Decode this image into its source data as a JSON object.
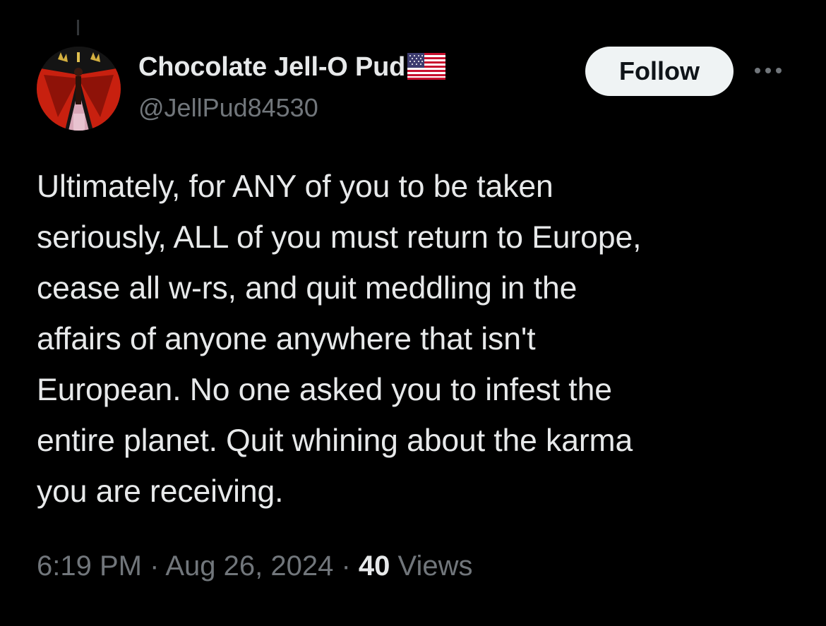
{
  "author": {
    "display_name": "Chocolate Jell-O Pud",
    "flag_icon": "us-flag-icon",
    "handle": "@JellPud84530"
  },
  "actions": {
    "follow_label": "Follow",
    "more_icon": "more-options-icon"
  },
  "tweet": {
    "lines": [
      "Ultimately, for ANY of you to be taken",
      "seriously, ALL of you must return to Europe,",
      "cease all w-rs, and quit meddling in the",
      "affairs of anyone anywhere that isn't",
      "European. No one asked you to infest the",
      "entire planet. Quit whining about the karma",
      "you are receiving."
    ]
  },
  "meta": {
    "time": "6:19 PM",
    "separator": "·",
    "date": "Aug 26, 2024",
    "views_count": "40",
    "views_label": "Views"
  },
  "colors": {
    "background": "#000000",
    "primary_text": "#e7e9ea",
    "secondary_text": "#71767b",
    "follow_button_bg": "#eff3f4"
  }
}
